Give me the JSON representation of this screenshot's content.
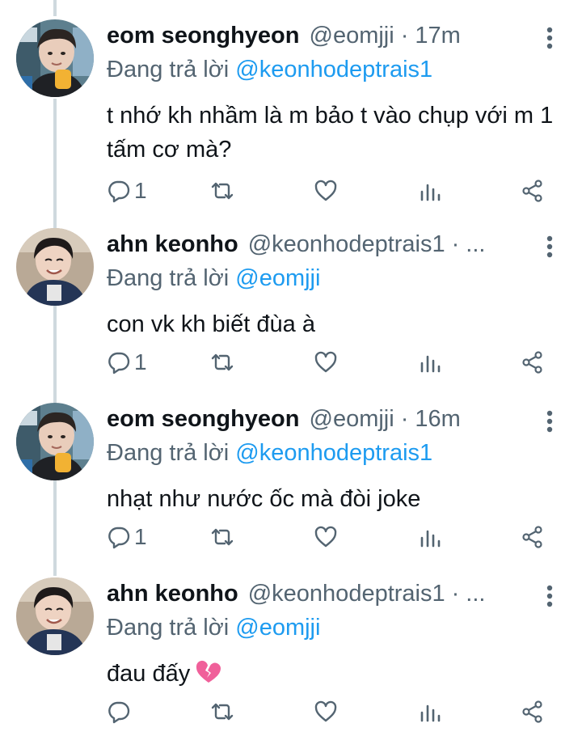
{
  "tweets": [
    {
      "display_name": "eom seonghyeon",
      "handle": "@eomjji",
      "dot": "·",
      "time": "17m",
      "reply_prefix": "Đang trả lời",
      "reply_to": "@keonhodeptrais1",
      "text": "t nhớ kh nhầm là m bảo t vào chụp với m 1 tấm cơ mà?",
      "reply_count": "1",
      "avatar": "avatar-eom"
    },
    {
      "display_name": "ahn keonho",
      "handle": "@keonhodeptrais1",
      "dot": "·",
      "time": "...",
      "reply_prefix": "Đang trả lời",
      "reply_to": "@eomjji",
      "text": "con vk kh biết đùa à",
      "reply_count": "1",
      "avatar": "avatar-ahn"
    },
    {
      "display_name": "eom seonghyeon",
      "handle": "@eomjji",
      "dot": "·",
      "time": "16m",
      "reply_prefix": "Đang trả lời",
      "reply_to": "@keonhodeptrais1",
      "text": "nhạt như nước ốc mà đòi joke",
      "reply_count": "1",
      "avatar": "avatar-eom"
    },
    {
      "display_name": "ahn keonho",
      "handle": "@keonhodeptrais1",
      "dot": "·",
      "time": "...",
      "reply_prefix": "Đang trả lời",
      "reply_to": "@eomjji",
      "text": "đau đấy",
      "emoji": "broken-heart-icon",
      "reply_count": "",
      "avatar": "avatar-ahn"
    }
  ],
  "icons": {
    "more": "more-vertical-icon",
    "reply": "reply-icon",
    "retweet": "retweet-icon",
    "like": "like-icon",
    "views": "views-icon",
    "share": "share-icon"
  },
  "colors": {
    "text": "#0f1419",
    "secondary": "#536471",
    "mention": "#1d9bf0",
    "thread_line": "#cfd9de",
    "broken_heart": "#f0609a"
  }
}
